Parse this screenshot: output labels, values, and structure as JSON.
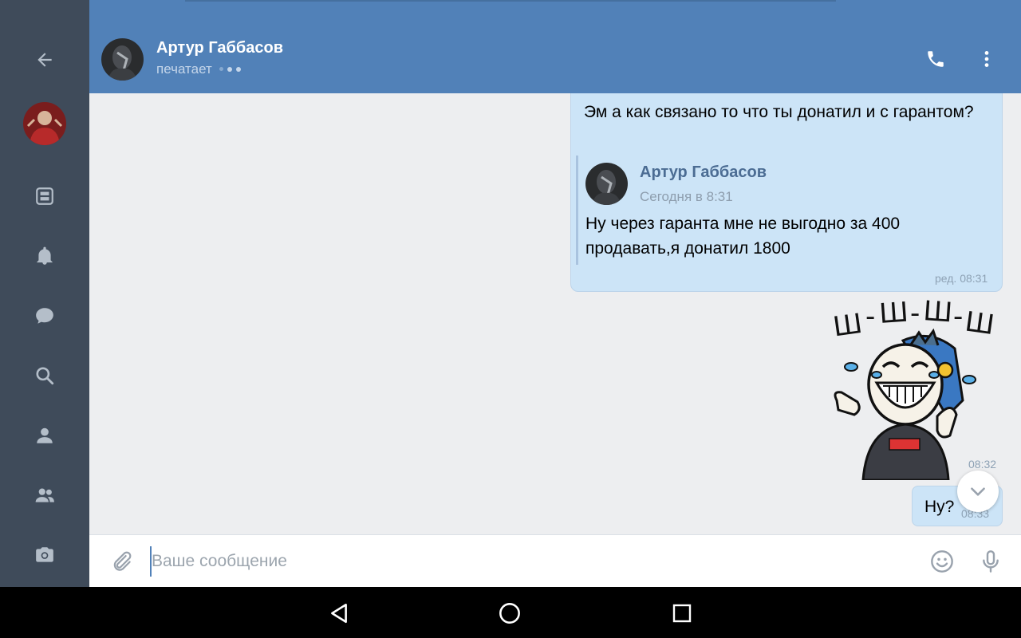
{
  "header": {
    "contact_name": "Артур Габбасов",
    "status": "печатает",
    "call_icon": "phone-icon",
    "menu_icon": "more-vertical-icon"
  },
  "sidebar": {
    "items": [
      {
        "icon": "back-arrow-icon"
      },
      {
        "icon": "user-avatar"
      },
      {
        "icon": "news-icon"
      },
      {
        "icon": "bell-icon"
      },
      {
        "icon": "messages-icon"
      },
      {
        "icon": "search-icon"
      },
      {
        "icon": "profile-icon"
      },
      {
        "icon": "friends-icon"
      },
      {
        "icon": "camera-icon"
      }
    ]
  },
  "messages": [
    {
      "text": "Эм а как связано то что ты донатил  и с гарантом?",
      "forwarded": {
        "author": "Артур Габбасов",
        "time": "Сегодня в 8:31",
        "text": "Ну через гаранта мне не выгодно за 400 продавать,я донатил 1800"
      },
      "meta": "ред. 08:31"
    },
    {
      "sticker": "sticker-laughing-skeleton",
      "sticker_caption": "Ш - Ш - Ш - Ш",
      "time": "08:32"
    },
    {
      "text": "Ну?",
      "time": "08:33"
    }
  ],
  "input": {
    "placeholder": "Ваше сообщение",
    "value": ""
  },
  "colors": {
    "header_bg": "#5181b8",
    "sidebar_bg": "#3f4b5a",
    "chat_bg": "#edeef0",
    "outgoing_bubble": "#cce4f7",
    "accent": "#5181b8"
  }
}
